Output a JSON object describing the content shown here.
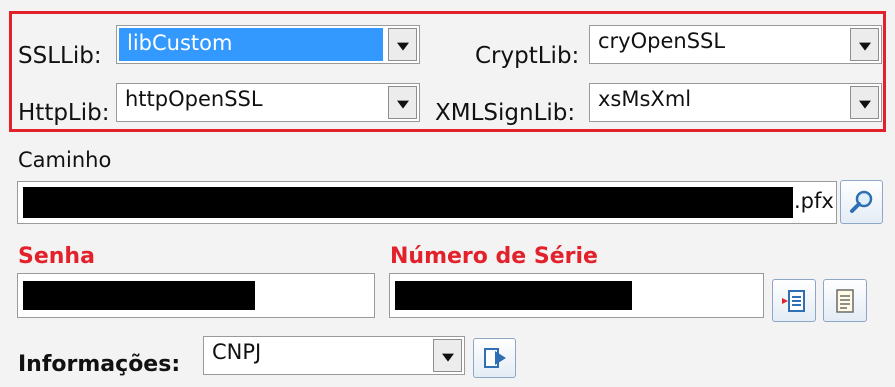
{
  "libs": {
    "ssllib_label": "SSLLib:",
    "ssllib_value": "libCustom",
    "cryptlib_label": "CryptLib:",
    "cryptlib_value": "cryOpenSSL",
    "httplib_label": "HttpLib:",
    "httplib_value": "httpOpenSSL",
    "xmlsignlib_label": "XMLSignLib:",
    "xmlsignlib_value": "xsMsXml"
  },
  "certificate": {
    "path_label": "Caminho",
    "path_suffix": ".pfx"
  },
  "credentials": {
    "password_label": "Senha",
    "serial_label": "Número de Série"
  },
  "info": {
    "label": "Informações:",
    "value": "CNPJ"
  },
  "colors": {
    "highlight_border": "#e2212b",
    "required_label": "#e2212b",
    "selection": "#3399ff"
  },
  "icons": [
    "search-icon",
    "select-certificate-icon",
    "certificate-info-icon",
    "go-icon"
  ]
}
